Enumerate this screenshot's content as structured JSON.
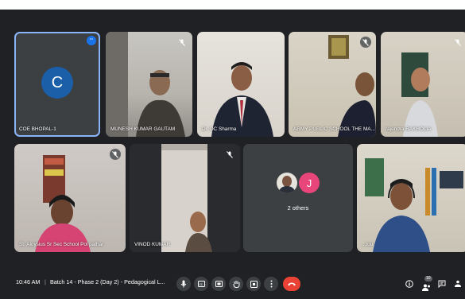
{
  "participants": [
    {
      "name": "COE BHOPAL-1",
      "initial": "C"
    },
    {
      "name": "MUNESH KUMAR GAUTAM"
    },
    {
      "name": "Dr. DC Sharma"
    },
    {
      "name": "ARMY PUBLIC SCHOOL THE MA..."
    },
    {
      "name": "rajendra RAKHOLIA"
    },
    {
      "name": "St. Aloysius Sr Sec School Pol pathar"
    },
    {
      "name": "VINOD KUMAR"
    },
    {
      "name": "...tou"
    }
  ],
  "others_tile": {
    "label": "2 others",
    "initial": "J"
  },
  "more_options_glyph": "•••",
  "bottom_bar": {
    "time": "10:46 AM",
    "separator": "|",
    "meeting_title": "Batch 14 - Phase 2 (Day 2) - Pedagogical L...",
    "participants_count": "10"
  },
  "colors": {
    "background": "#202124",
    "tile": "#3c4043",
    "active_border": "#8ab4f8",
    "avatar_blue": "#1a5fa8",
    "avatar_pink": "#e8457a",
    "end_call": "#ea4335"
  },
  "icons": [
    "microphone-icon",
    "closed-caption-icon",
    "present-screen-icon",
    "raise-hand-icon",
    "activities-icon",
    "more-options-icon",
    "end-call-icon",
    "info-icon",
    "people-icon",
    "chat-icon",
    "host-controls-icon",
    "mic-off-icon"
  ]
}
